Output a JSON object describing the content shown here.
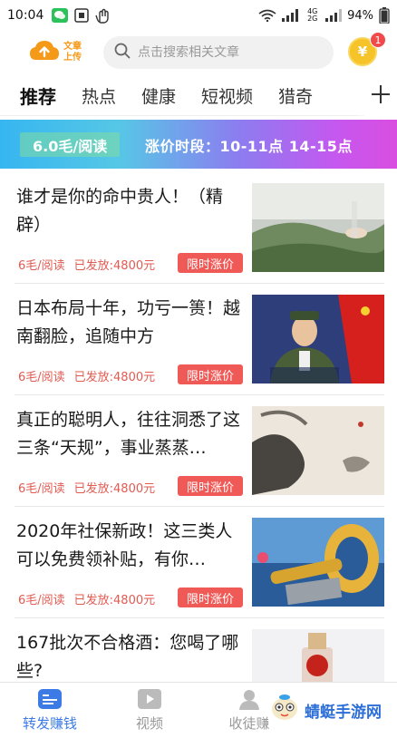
{
  "status_bar": {
    "time": "10:04",
    "network": "4G 2G",
    "battery": "94%"
  },
  "header": {
    "upload_label_line1": "文章",
    "upload_label_line2": "上传",
    "search_placeholder": "点击搜索相关文章",
    "coin_symbol": "¥",
    "coin_badge": "1"
  },
  "tabs": [
    "推荐",
    "热点",
    "健康",
    "短视频",
    "猎奇"
  ],
  "banner": {
    "left_text": "6.0毛/阅读",
    "right_text": "涨价时段：10-11点 14-15点"
  },
  "articles": [
    {
      "title": "谁才是你的命中贵人！（精辟）",
      "rate": "6毛/阅读",
      "paid": "已发放:4800元",
      "tag": "限时涨价"
    },
    {
      "title": "日本布局十年，功亏一篑！越南翻脸，追随中方",
      "rate": "6毛/阅读",
      "paid": "已发放:4800元",
      "tag": "限时涨价"
    },
    {
      "title": "真正的聪明人，往往洞悉了这三条“天规”，事业蒸蒸…",
      "rate": "6毛/阅读",
      "paid": "已发放:4800元",
      "tag": "限时涨价"
    },
    {
      "title": "2020年社保新政！这三类人可以免费领补贴，有你…",
      "rate": "6毛/阅读",
      "paid": "已发放:4800元",
      "tag": "限时涨价"
    },
    {
      "title": "167批次不合格酒：您喝了哪些?",
      "rate": "",
      "paid": "",
      "tag": ""
    }
  ],
  "bottom_nav": [
    {
      "label": "转发赚钱",
      "active": true
    },
    {
      "label": "视频",
      "active": false
    },
    {
      "label": "收徒赚",
      "active": false
    }
  ],
  "watermark": "蜻蜓手游网",
  "colors": {
    "accent": "#3c7be6",
    "price_red": "#e25b52",
    "tag_red": "#ef5a57",
    "coin_gold": "#f6c328",
    "upload_orange": "#f59a18"
  }
}
